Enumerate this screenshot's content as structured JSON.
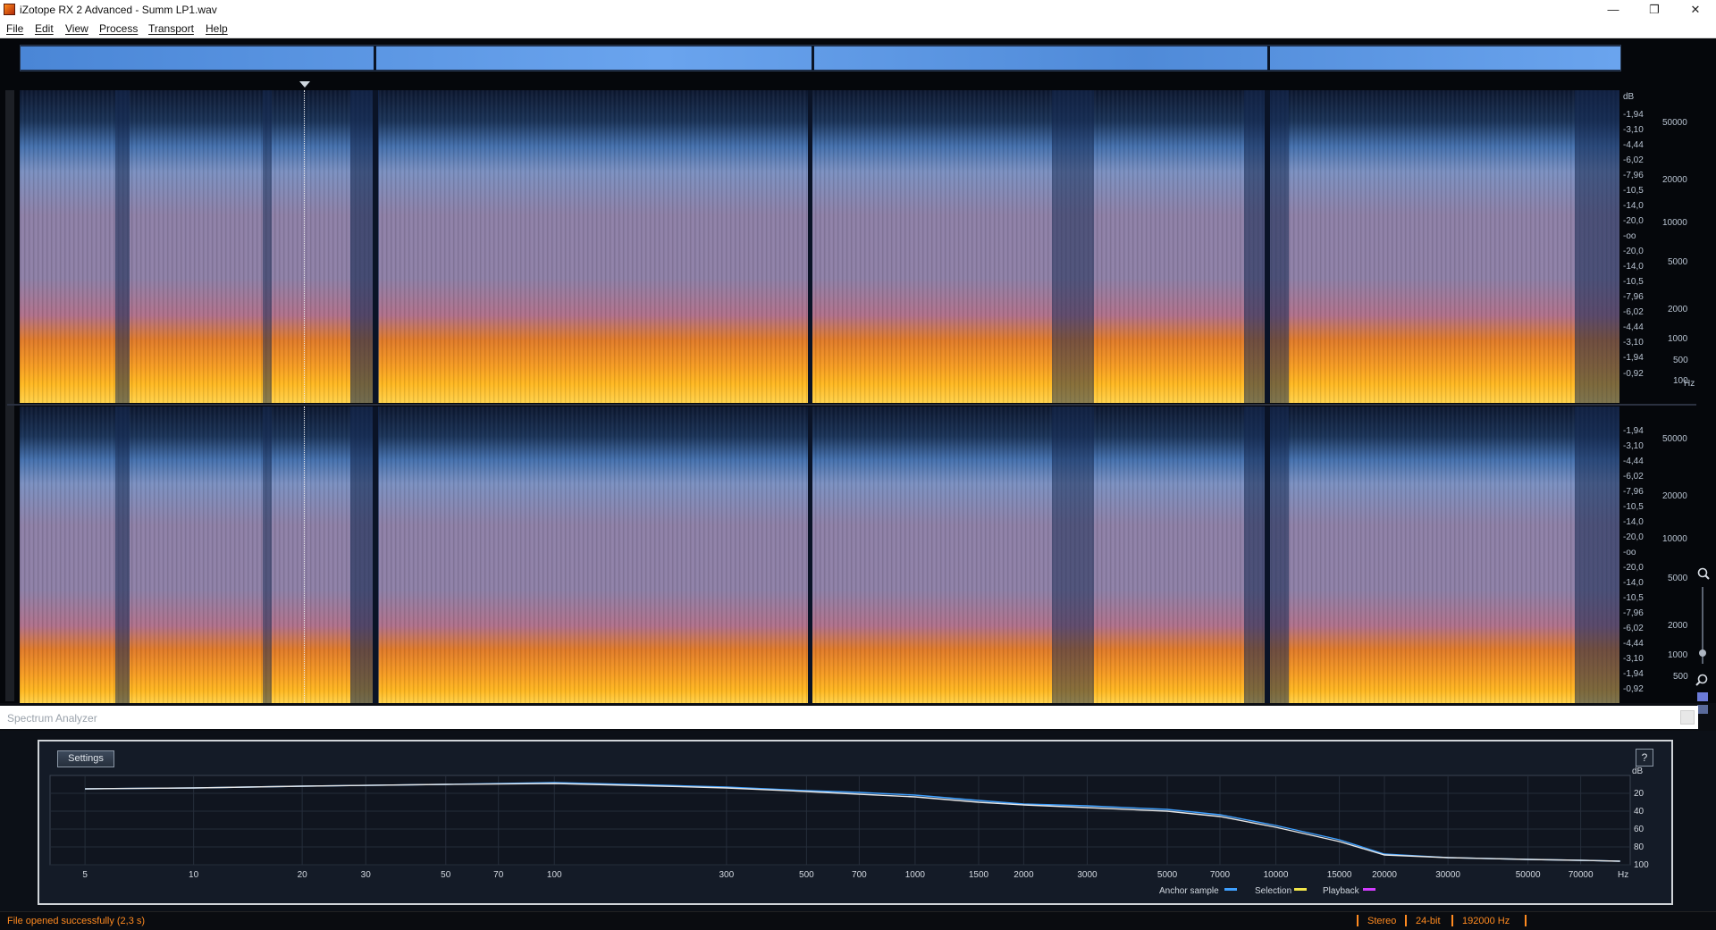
{
  "window": {
    "title": "iZotope RX 2 Advanced - Summ LP1.wav",
    "minimize_glyph": "—",
    "maximize_glyph": "❐",
    "close_glyph": "✕"
  },
  "menu": [
    "File",
    "Edit",
    "View",
    "Process",
    "Transport",
    "Help"
  ],
  "spectrogram": {
    "db_unit": "dB",
    "hz_unit": "Hz",
    "db_scale": [
      "-1,94",
      "-3,10",
      "-4,44",
      "-6,02",
      "-7,96",
      "-10,5",
      "-14,0",
      "-20,0",
      "-oo",
      "-20,0",
      "-14,0",
      "-10,5",
      "-7,96",
      "-6,02",
      "-4,44",
      "-3,10",
      "-1,94",
      "-0,92"
    ],
    "freq_scale": [
      "50000",
      "20000",
      "10000",
      "5000",
      "2000",
      "1000",
      "500",
      "100"
    ],
    "db_scale_bottom": [
      "-1,94",
      "-3,10",
      "-4,44",
      "-6,02",
      "-7,96",
      "-10,5",
      "-14,0",
      "-20,0",
      "-oo",
      "-20,0",
      "-14,0",
      "-10,5",
      "-7,96",
      "-6,02",
      "-4,44",
      "-3,10",
      "-1,94",
      "-0,92"
    ],
    "freq_scale_bottom": [
      "50000",
      "20000",
      "10000",
      "5000",
      "2000",
      "1000",
      "500"
    ]
  },
  "spectrum_analyzer": {
    "title": "Spectrum Analyzer",
    "settings_label": "Settings",
    "help_label": "?",
    "db_unit": "dB",
    "db_ticks": [
      "20",
      "40",
      "60",
      "80",
      "100"
    ],
    "hz_unit": "Hz",
    "freq_ticks": [
      "5",
      "10",
      "20",
      "30",
      "50",
      "70",
      "100",
      "300",
      "500",
      "700",
      "1000",
      "1500",
      "2000",
      "3000",
      "5000",
      "7000",
      "10000",
      "15000",
      "20000",
      "30000",
      "50000",
      "70000"
    ],
    "legend": [
      {
        "label": "Anchor sample",
        "color": "#3fa0ff"
      },
      {
        "label": "Selection",
        "color": "#f2e64a"
      },
      {
        "label": "Playback",
        "color": "#d23cff"
      }
    ]
  },
  "chart_data": {
    "type": "line",
    "title": "",
    "xlabel": "Hz",
    "ylabel": "dB",
    "x_scale": "log",
    "ylim": [
      0,
      100
    ],
    "series": [
      {
        "color": "#3fa0ff",
        "x": [
          5,
          10,
          20,
          50,
          100,
          200,
          300,
          500,
          700,
          1000,
          1500,
          2000,
          3000,
          5000,
          7000,
          10000,
          15000,
          20000,
          30000,
          50000,
          70000,
          90000
        ],
        "y": [
          15,
          14,
          12,
          10,
          8,
          11,
          13,
          17,
          19,
          22,
          28,
          32,
          34,
          38,
          44,
          56,
          72,
          88,
          92,
          94,
          95,
          96
        ]
      },
      {
        "color": "#e6e6e6",
        "x": [
          5,
          10,
          20,
          50,
          100,
          200,
          300,
          500,
          700,
          1000,
          1500,
          2000,
          3000,
          5000,
          7000,
          10000,
          15000,
          20000,
          30000,
          50000,
          70000,
          90000
        ],
        "y": [
          15,
          14,
          12,
          10,
          9,
          12,
          14,
          18,
          21,
          24,
          30,
          33,
          36,
          40,
          46,
          58,
          74,
          89,
          92,
          94,
          95,
          96
        ]
      }
    ]
  },
  "status": {
    "message": "File opened successfully (2,3 s)",
    "channels": "Stereo",
    "bit_depth": "24-bit",
    "sample_rate": "192000 Hz"
  }
}
